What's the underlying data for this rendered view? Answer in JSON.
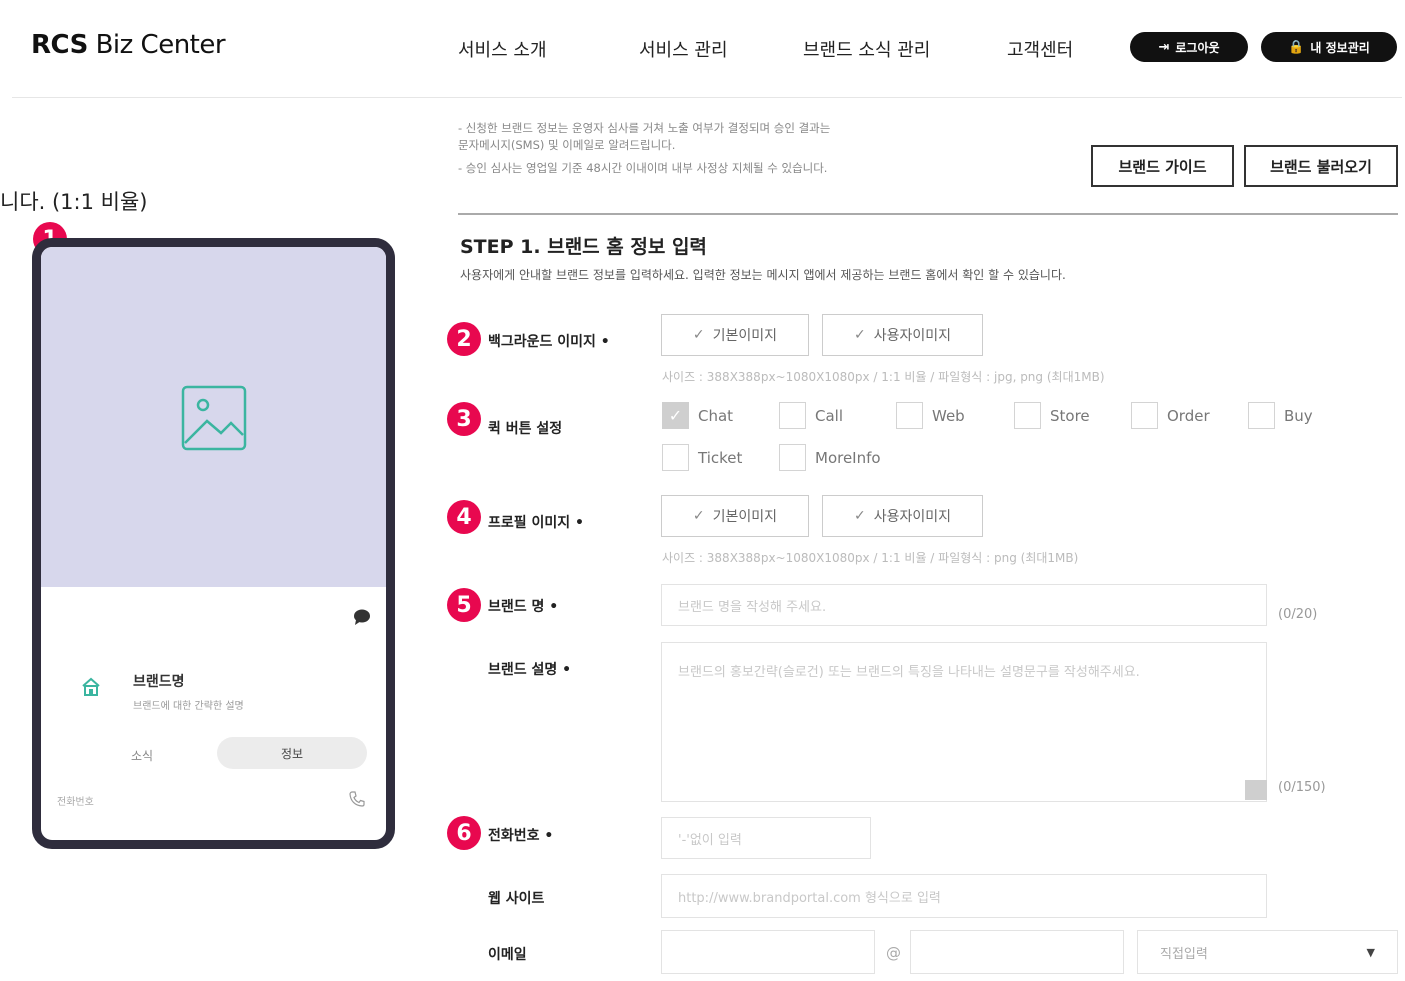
{
  "header": {
    "logo_bold": "RCS",
    "logo_light": "Biz Center",
    "nav": [
      "서비스 소개",
      "서비스 관리",
      "브랜드 소식 관리",
      "고객센터"
    ],
    "logout_label": "로그아웃",
    "my_info_label": "내 정보관리"
  },
  "preview": {
    "ratio_note": "니다. (1:1 비율)",
    "badges": [
      "1",
      "2",
      "3",
      "4",
      "5",
      "6"
    ],
    "brand_name": "브랜드명",
    "brand_desc": "브랜드에 대한 간략한 설명",
    "tab_news": "소식",
    "tab_info": "정보",
    "phone_label": "전화번호"
  },
  "notice": {
    "lines": [
      "- 신청한 브랜드 정보는 운영자 심사를 거쳐 노출 여부가 결정되며 승인 결과는",
      "  문자메시지(SMS) 및 이메일로 알려드립니다.",
      "- 승인 심사는 영업일 기준 48시간 이내이며 내부 사정상 지체될 수 있습니다."
    ],
    "guide_button": "브랜드 가이드",
    "load_button": "브랜드 불러오기"
  },
  "step": {
    "title": "STEP 1. 브랜드 홈 정보 입력",
    "desc": "사용자에게 안내할 브랜드 정보를 입력하세요. 입력한 정보는 메시지 앱에서 제공하는 브랜드 홈에서 확인 할 수 있습니다."
  },
  "form": {
    "background_label": "백그라운드 이미지 •",
    "default_image": "기본이미지",
    "user_image": "사용자이미지",
    "background_hint": "사이즈 : 388X388px~1080X1080px / 1:1 비율 / 파일형식 : jpg, png (최대1MB)",
    "quick_label": "퀵 버튼 설정",
    "quick_buttons": [
      "Chat",
      "Call",
      "Web",
      "Store",
      "Order",
      "Buy",
      "Ticket",
      "MoreInfo"
    ],
    "profile_label": "프로필 이미지 •",
    "profile_hint": "사이즈 : 388X388px~1080X1080px / 1:1 비율 / 파일형식 : png (최대1MB)",
    "brand_name_label": "브랜드 명 •",
    "brand_name_placeholder": "브랜드 명을 작성해 주세요.",
    "brand_name_counter": "(0/20)",
    "brand_desc_label": "브랜드 설명 •",
    "brand_desc_placeholder": "브랜드의 홍보간략(슬로건) 또는 브랜드의 특징을 나타내는 설명문구를 작성해주세요.",
    "brand_desc_counter": "(0/150)",
    "phone_label": "전화번호 •",
    "phone_placeholder": "'-'없이 입력",
    "web_label": "웹 사이트",
    "web_placeholder": "http://www.brandportal.com 형식으로 입력",
    "email_label": "이메일",
    "email_at": "@",
    "email_select": "직접입력"
  },
  "colors": {
    "badge": "#e8084f",
    "phone_frame": "#2f2d3d",
    "phone_bg": "#d7d7ec",
    "accent_teal": "#3bb5a0"
  }
}
